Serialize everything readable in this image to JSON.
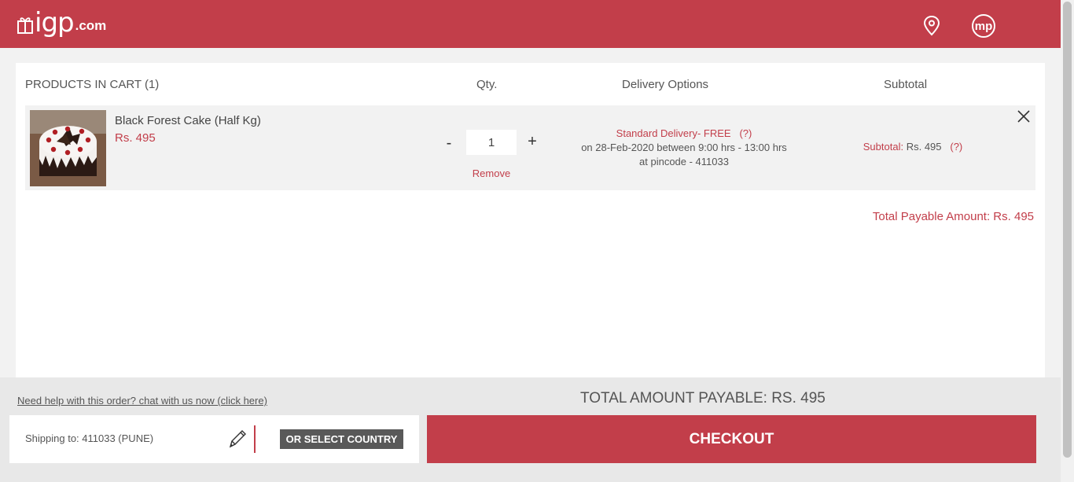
{
  "header": {
    "logo_brand": "igp",
    "logo_domain": ".com",
    "location_icon": "location-pin-icon",
    "avatar_initials": "mp"
  },
  "cart": {
    "col_products": "PRODUCTS IN CART (1)",
    "col_qty": "Qty.",
    "col_delivery": "Delivery Options",
    "col_subtotal": "Subtotal",
    "item": {
      "name": "Black Forest Cake (Half Kg)",
      "price": "Rs. 495",
      "qty_minus": "-",
      "qty_value": "1",
      "qty_plus": "+",
      "remove_label": "Remove",
      "delivery_type": "Standard Delivery- FREE",
      "delivery_help": "(?)",
      "delivery_when": "on 28-Feb-2020 between 9:00 hrs - 13:00 hrs",
      "delivery_pincode": "at pincode - 411033",
      "subtotal_label": "Subtotal:",
      "subtotal_value": "Rs. 495",
      "subtotal_help": "(?)"
    },
    "total_payable": "Total Payable Amount: Rs. 495"
  },
  "footer": {
    "help_link": "Need help with this order? chat with us now (click here)",
    "grand_total": "TOTAL AMOUNT PAYABLE: RS. 495",
    "shipping_to": "Shipping to: 411033 (PUNE)",
    "select_country_label": "OR SELECT COUNTRY",
    "checkout_label": "CHECKOUT"
  },
  "colors": {
    "brand": "#c23e4a",
    "dark_button": "#595959",
    "panel_bg": "#ffffff",
    "row_bg": "#f2f2f2"
  }
}
